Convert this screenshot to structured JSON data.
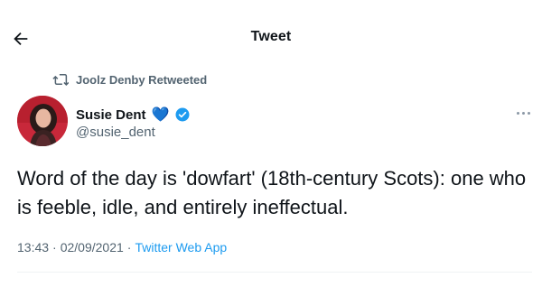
{
  "header": {
    "title": "Tweet",
    "back_icon": "arrow-left-icon"
  },
  "retweet": {
    "icon": "retweet-icon",
    "text": "Joolz Denby Retweeted"
  },
  "author": {
    "name": "Susie Dent",
    "handle": "@susie_dent",
    "heart_emoji": "💙",
    "verified_icon": "verified-badge-icon",
    "avatar_icon": "avatar-photo"
  },
  "tweet": {
    "text": "Word of the day is 'dowfart' (18th-century Scots): one who is feeble, idle, and entirely ineffectual.",
    "time": "13:43",
    "date": "02/09/2021",
    "separator": "·",
    "source": "Twitter Web App"
  },
  "more_icon": "more-dots-icon",
  "colors": {
    "text_primary": "#0f1419",
    "text_secondary": "#536471",
    "accent": "#1d9bf0",
    "heart": "#1d7ee6",
    "divider": "#eff3f4"
  }
}
